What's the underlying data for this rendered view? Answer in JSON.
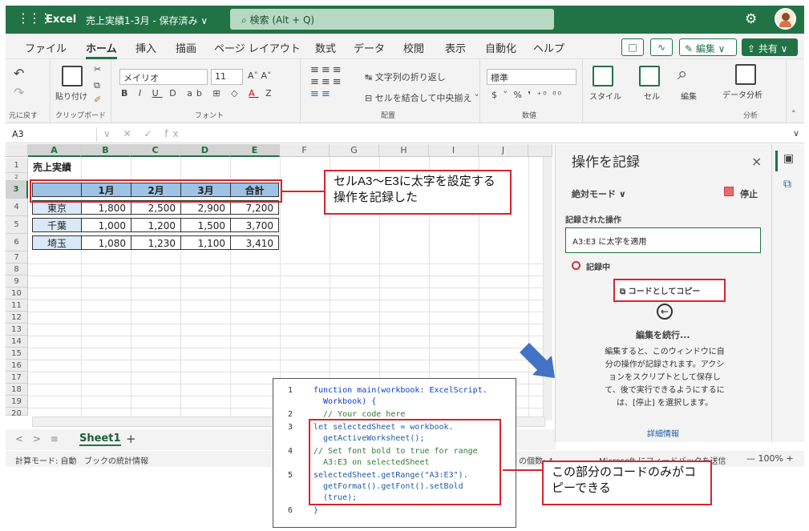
{
  "titlebar": {
    "waffle": "⋮⋮⋮",
    "app": "Excel",
    "doc": "売上実績1-3月 - 保存済み ∨",
    "search": "⌕  検索 (Alt + Q)",
    "gear": "⚙",
    "brand_color": "#217346"
  },
  "tabs": [
    "ファイル",
    "ホーム",
    "挿入",
    "描画",
    "ページ レイアウト",
    "数式",
    "データ",
    "校閲",
    "表示",
    "自動化",
    "ヘルプ"
  ],
  "tab_buttons": {
    "comment": "□",
    "catchup": "∿",
    "edit": "✎ 編集 ∨",
    "share": "⇪ 共有 ∨"
  },
  "ribbon": {
    "undo_label": "元に戻す",
    "paste": "貼り付け",
    "clipboard": "クリップボード",
    "font_name": "メイリオ",
    "font_size": "11",
    "font_group": "フォント",
    "wrap_text": "文字列の折り返し",
    "merge_center": "セルを結合して中央揃え ˅",
    "align_group": "配置",
    "number_format": "標準",
    "number_group": "数値",
    "style": "スタイル",
    "cell": "セル",
    "edit": "編集",
    "data_analysis": "データ分析",
    "analysis_group": "分析"
  },
  "namebox": "A3",
  "fx": "∨  ✕  ✓  fx",
  "grid": {
    "columns": [
      "A",
      "B",
      "C",
      "D",
      "E",
      "F",
      "G",
      "H",
      "I",
      "J"
    ],
    "rows": [
      "1",
      "2",
      "3",
      "4",
      "5",
      "6",
      "7",
      "8",
      "9",
      "10",
      "11",
      "12",
      "13",
      "14",
      "15",
      "16",
      "17",
      "18",
      "19",
      "20"
    ],
    "title": "売上実績",
    "header": [
      "",
      "1月",
      "2月",
      "3月",
      "合計"
    ],
    "data": [
      [
        "東京",
        "1,800",
        "2,500",
        "2,900",
        "7,200"
      ],
      [
        "千葉",
        "1,000",
        "1,200",
        "1,500",
        "3,700"
      ],
      [
        "埼玉",
        "1,080",
        "1,230",
        "1,100",
        "3,410"
      ]
    ]
  },
  "sheetbar": {
    "nav": "<  >  ≡",
    "sheet": "Sheet1",
    "add": "+"
  },
  "status": {
    "mode": "計算モード: 自動",
    "stats": "ブックの統計情報",
    "count": "の個数: 4",
    "feedback": "Microsoft にフィードバックを送信",
    "zoom": "—  100%  +"
  },
  "panel": {
    "title": "操作を記録",
    "close": "×",
    "mode": "絶対モード ∨",
    "stop": "停止",
    "recorded_label": "記録された操作",
    "action": "A3:E3 に太字を適用",
    "recording": "記録中",
    "copy_code": "コードとしてコピー",
    "back_icon": "←",
    "continue": "編集を続行...",
    "desc": "編集すると、このウィンドウに自分の操作が記録されます。アクションをスクリプトとして保存して、後で実行できるようにするには、[停止] を選択します。",
    "more": "詳細情報"
  },
  "callout1": "セルA3～E3に太字を設定する操作を記録した",
  "callout2": "この部分のコードのみがコピーできる",
  "code": {
    "line_numbers": [
      "1",
      "2",
      "3",
      "4",
      "5",
      "6"
    ],
    "l1": "function main(workbook: ExcelScript.",
    "l1b": "  Workbook) {",
    "l2": "  // Your code here",
    "l3": "let selectedSheet = workbook.",
    "l3b": "  getActiveWorksheet();",
    "l4": "// Set font bold to true for range",
    "l4b": "  A3:E3 on selectedSheet",
    "l5": "selectedSheet.getRange(\"A3:E3\").",
    "l5b": "  getFormat().getFont().setBold",
    "l5c": "  (true);",
    "l6": "}"
  },
  "colors": {
    "header_fill": "#9dc3e6",
    "callout_border": "#d9232f",
    "arrow": "#4472c4"
  }
}
